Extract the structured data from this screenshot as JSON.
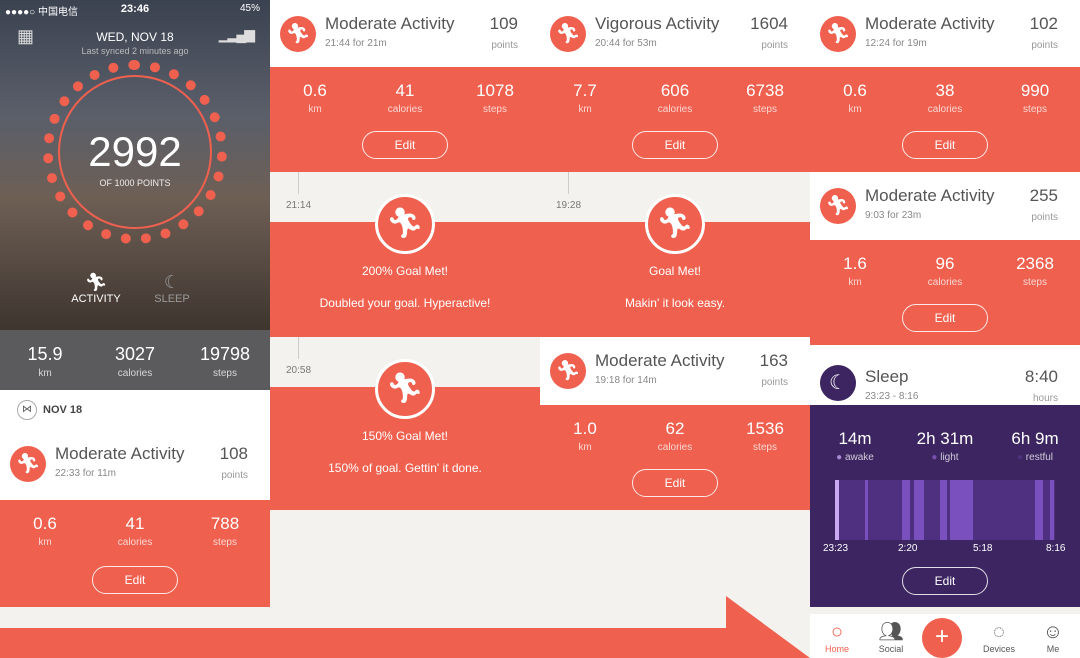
{
  "status_bar": {
    "carrier": "●●●●○ 中国电信",
    "wifi_icon": "wifi-icon",
    "time": "23:46",
    "battery": "45%"
  },
  "home": {
    "date": "WED, NOV 18",
    "synced": "Last synced 2 minutes ago",
    "points": "2992",
    "goal": "OF 1000 POINTS",
    "progress_fraction": 1.0,
    "tabs": [
      {
        "label": "ACTIVITY",
        "icon": "runner-icon"
      },
      {
        "label": "SLEEP",
        "icon": "moon-icon"
      }
    ],
    "totals": [
      {
        "value": "15.9",
        "label": "km"
      },
      {
        "value": "3027",
        "label": "calories"
      },
      {
        "value": "19798",
        "label": "steps"
      }
    ],
    "day_label": "NOV 18"
  },
  "colors": {
    "coral": "#f0604f",
    "purple": "#3c2560"
  },
  "cards": [
    {
      "title": "Moderate Activity",
      "sub": "22:33 for 11m",
      "points": "108",
      "points_label": "points",
      "stats": [
        {
          "v": "0.6",
          "l": "km"
        },
        {
          "v": "41",
          "l": "calories"
        },
        {
          "v": "788",
          "l": "steps"
        }
      ],
      "edit": "Edit"
    },
    {
      "title": "Moderate Activity",
      "sub": "21:44 for 21m",
      "points": "109",
      "points_label": "points",
      "stats": [
        {
          "v": "0.6",
          "l": "km"
        },
        {
          "v": "41",
          "l": "calories"
        },
        {
          "v": "1078",
          "l": "steps"
        }
      ],
      "edit": "Edit"
    },
    {
      "title": "Vigorous Activity",
      "sub": "20:44 for 53m",
      "points": "1604",
      "points_label": "points",
      "stats": [
        {
          "v": "7.7",
          "l": "km"
        },
        {
          "v": "606",
          "l": "calories"
        },
        {
          "v": "6738",
          "l": "steps"
        }
      ],
      "edit": "Edit"
    },
    {
      "title": "Moderate Activity",
      "sub": "19:18 for 14m",
      "points": "163",
      "points_label": "points",
      "stats": [
        {
          "v": "1.0",
          "l": "km"
        },
        {
          "v": "62",
          "l": "calories"
        },
        {
          "v": "1536",
          "l": "steps"
        }
      ],
      "edit": "Edit"
    },
    {
      "title": "Moderate Activity",
      "sub": "12:24 for 19m",
      "points": "102",
      "points_label": "points",
      "stats": [
        {
          "v": "0.6",
          "l": "km"
        },
        {
          "v": "38",
          "l": "calories"
        },
        {
          "v": "990",
          "l": "steps"
        }
      ],
      "edit": "Edit"
    },
    {
      "title": "Moderate Activity",
      "sub": "9:03 for 23m",
      "points": "255",
      "points_label": "points",
      "stats": [
        {
          "v": "1.6",
          "l": "km"
        },
        {
          "v": "96",
          "l": "calories"
        },
        {
          "v": "2368",
          "l": "steps"
        }
      ],
      "edit": "Edit"
    }
  ],
  "goals": [
    {
      "time": "21:14",
      "title": "200% Goal Met!",
      "sub": "Doubled your goal. Hyperactive!"
    },
    {
      "time": "20:58",
      "title": "150% Goal Met!",
      "sub": "150% of goal. Gettin' it done."
    },
    {
      "time": "19:28",
      "title": "Goal Met!",
      "sub": "Makin' it look easy."
    }
  ],
  "sleep": {
    "title": "Sleep",
    "sub": "23:23 - 8:16",
    "value": "8:40",
    "value_label": "hours",
    "stats": [
      {
        "v": "14m",
        "l": "awake"
      },
      {
        "v": "2h 31m",
        "l": "light"
      },
      {
        "v": "6h 9m",
        "l": "restful"
      }
    ],
    "axis": [
      "23:23",
      "2:20",
      "5:18",
      "8:16"
    ],
    "edit": "Edit"
  },
  "tabbar": [
    {
      "label": "Home",
      "icon": "home-circle-icon"
    },
    {
      "label": "Social",
      "icon": "people-icon"
    },
    {
      "label": "",
      "icon": "add-icon"
    },
    {
      "label": "Devices",
      "icon": "band-icon"
    },
    {
      "label": "Me",
      "icon": "person-icon"
    }
  ]
}
